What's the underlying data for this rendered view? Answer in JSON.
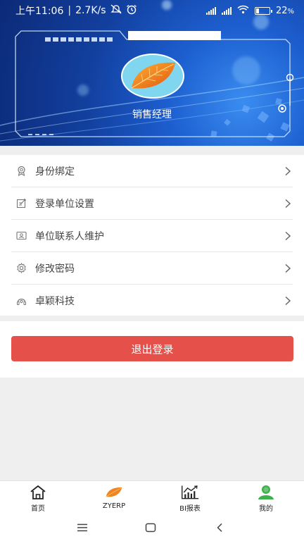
{
  "status_bar": {
    "time": "上午11:06",
    "network_speed": "2.7K/s",
    "battery_percent": "22",
    "battery_suffix": "%",
    "battery_level": 0.22,
    "icons": [
      "mute-notification-icon",
      "alarm-icon",
      "hd-signal-icon",
      "hd-signal-icon",
      "wifi-icon",
      "battery-icon"
    ]
  },
  "profile": {
    "role": "销售经理",
    "avatar_icon": "leaf-icon"
  },
  "menu": {
    "items": [
      {
        "label": "身份绑定",
        "icon": "badge-icon"
      },
      {
        "label": "登录单位设置",
        "icon": "edit-icon"
      },
      {
        "label": "单位联系人维护",
        "icon": "contact-card-icon"
      },
      {
        "label": "修改密码",
        "icon": "gear-icon"
      },
      {
        "label": "卓颖科技",
        "icon": "headset-icon"
      }
    ]
  },
  "logout": {
    "label": "退出登录"
  },
  "tabs": [
    {
      "label": "首页",
      "icon": "home-icon"
    },
    {
      "label": "ZYERP",
      "icon": "leaf-icon"
    },
    {
      "label": "BI报表",
      "icon": "chart-icon"
    },
    {
      "label": "我的",
      "icon": "user-icon"
    }
  ],
  "colors": {
    "accent": "#e6504a",
    "banner_dark": "#0c2a77",
    "banner_light": "#3a8df0",
    "active_tab": "#3cb04a"
  }
}
